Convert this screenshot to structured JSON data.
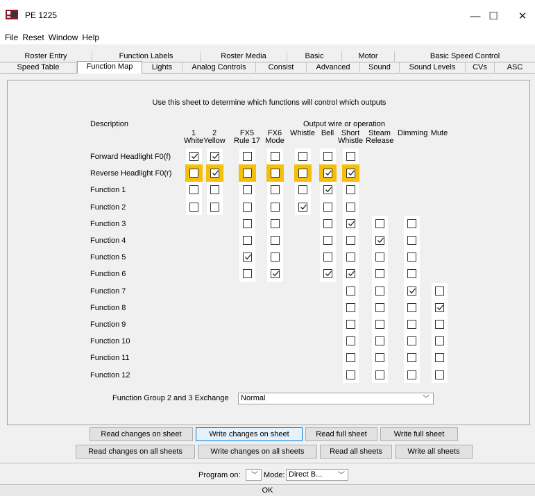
{
  "window": {
    "title": "PE 1225",
    "minimize": "—",
    "maximize": "☐",
    "close": "✕"
  },
  "menu": [
    "File",
    "Reset",
    "Window",
    "Help"
  ],
  "tabs_row1": [
    "Roster Entry",
    "Function Labels",
    "Roster Media",
    "Basic",
    "Motor",
    "Basic Speed Control"
  ],
  "tabs_row2": [
    "Speed Table",
    "Function Map",
    "Lights",
    "Analog Controls",
    "Consist",
    "Advanced",
    "Sound",
    "Sound Levels",
    "CVs",
    "ASC"
  ],
  "active_tab": "Function Map",
  "sheet": {
    "instruction": "Use this sheet to determine which functions will control which outputs",
    "description_header": "Description",
    "output_header": "Output wire or operation",
    "columns": [
      {
        "top": "1",
        "bottom": "White"
      },
      {
        "top": "2",
        "bottom": "Yellow"
      },
      {
        "top": "FX5",
        "bottom": "Rule 17"
      },
      {
        "top": "FX6",
        "bottom": "Mode"
      },
      {
        "top": "Whistle",
        "bottom": ""
      },
      {
        "top": "Bell",
        "bottom": ""
      },
      {
        "top": "Short",
        "bottom": "Whistle"
      },
      {
        "top": "Steam",
        "bottom": "Release"
      },
      {
        "top": "Dimming",
        "bottom": ""
      },
      {
        "top": "Mute",
        "bottom": ""
      }
    ],
    "rows": [
      {
        "label": "Forward Headlight F0(f)",
        "cells": [
          1,
          1,
          0,
          0,
          0,
          0,
          0,
          null,
          null,
          null
        ],
        "highlight": false
      },
      {
        "label": "Reverse Headlight F0(r)",
        "cells": [
          0,
          1,
          0,
          0,
          0,
          1,
          1,
          null,
          null,
          null
        ],
        "highlight": true
      },
      {
        "label": "Function 1",
        "cells": [
          0,
          0,
          0,
          0,
          0,
          1,
          0,
          null,
          null,
          null
        ],
        "highlight": false
      },
      {
        "label": "Function 2",
        "cells": [
          0,
          0,
          0,
          0,
          1,
          0,
          0,
          null,
          null,
          null
        ],
        "highlight": false
      },
      {
        "label": "Function 3",
        "cells": [
          null,
          null,
          0,
          0,
          null,
          0,
          1,
          0,
          0,
          null
        ],
        "highlight": false
      },
      {
        "label": "Function 4",
        "cells": [
          null,
          null,
          0,
          0,
          null,
          0,
          0,
          1,
          0,
          null
        ],
        "highlight": false
      },
      {
        "label": "Function 5",
        "cells": [
          null,
          null,
          1,
          0,
          null,
          0,
          0,
          0,
          0,
          null
        ],
        "highlight": false
      },
      {
        "label": "Function 6",
        "cells": [
          null,
          null,
          0,
          1,
          null,
          1,
          1,
          0,
          0,
          null
        ],
        "highlight": false
      },
      {
        "label": "Function 7",
        "cells": [
          null,
          null,
          null,
          null,
          null,
          null,
          0,
          0,
          1,
          0
        ],
        "highlight": false
      },
      {
        "label": "Function 8",
        "cells": [
          null,
          null,
          null,
          null,
          null,
          null,
          0,
          0,
          0,
          1
        ],
        "highlight": false
      },
      {
        "label": "Function 9",
        "cells": [
          null,
          null,
          null,
          null,
          null,
          null,
          0,
          0,
          0,
          0
        ],
        "highlight": false
      },
      {
        "label": "Function 10",
        "cells": [
          null,
          null,
          null,
          null,
          null,
          null,
          0,
          0,
          0,
          0
        ],
        "highlight": false
      },
      {
        "label": "Function 11",
        "cells": [
          null,
          null,
          null,
          null,
          null,
          null,
          0,
          0,
          0,
          0
        ],
        "highlight": false
      },
      {
        "label": "Function 12",
        "cells": [
          null,
          null,
          null,
          null,
          null,
          null,
          0,
          0,
          0,
          0
        ],
        "highlight": false
      }
    ],
    "exchange_label": "Function Group 2 and 3 Exchange",
    "exchange_value": "Normal"
  },
  "buttons": {
    "read_changes_sheet": "Read changes on sheet",
    "write_changes_sheet": "Write changes on sheet",
    "read_full_sheet": "Read full sheet",
    "write_full_sheet": "Write full sheet",
    "read_changes_all": "Read changes on all sheets",
    "write_changes_all": "Write changes on all sheets",
    "read_all": "Read all sheets",
    "write_all": "Write all sheets",
    "ok": "OK"
  },
  "program": {
    "program_on_label": "Program on:",
    "program_on_value": "",
    "mode_label": "Mode:",
    "mode_value": "Direct B..."
  },
  "colors": {
    "highlight": "#f5bf0c",
    "focus_border": "#0078d7"
  }
}
